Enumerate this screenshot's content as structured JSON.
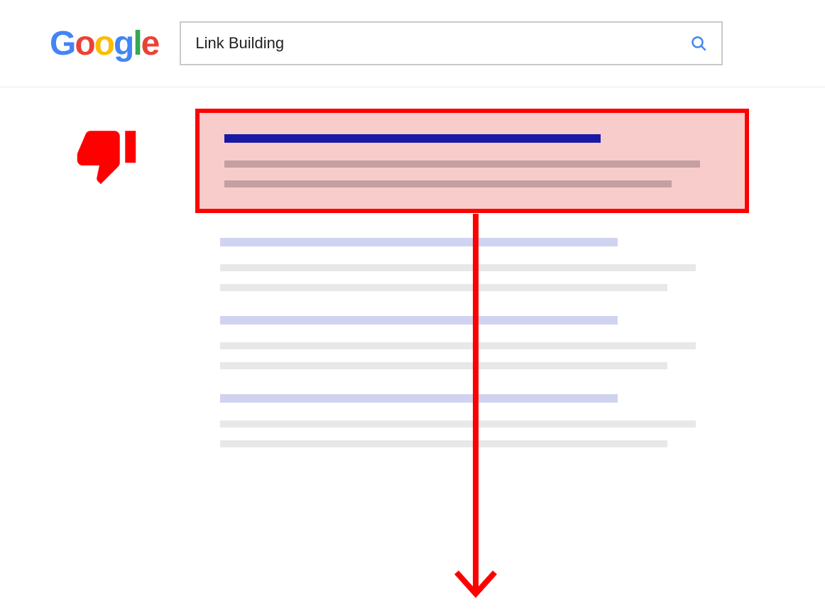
{
  "brand": {
    "g1": "G",
    "o1": "o",
    "o2": "o",
    "g2": "g",
    "l": "l",
    "e": "e"
  },
  "search": {
    "query": "Link Building"
  },
  "annotations": {
    "sentiment": "thumbs-down",
    "highlight_color": "#ff0000",
    "highlight_fill": "#f9cccc",
    "arrow_direction": "down"
  }
}
